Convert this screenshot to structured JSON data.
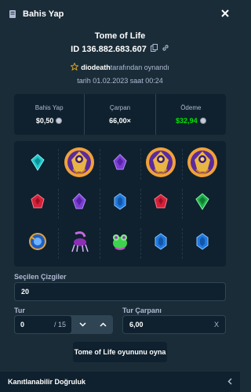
{
  "header": {
    "title": "Bahis Yap",
    "icon": "bet-slip-icon",
    "close_icon": "close-icon"
  },
  "game": {
    "title": "Tome of Life"
  },
  "bet": {
    "id": "ID 136.882.683.607"
  },
  "player": {
    "name": "diodeath",
    "suffix": "tarafından oynandı"
  },
  "date": "tarih 01.02.2023 saat 00:24",
  "stats": [
    {
      "label": "Bahis Yap",
      "value": "$0,50",
      "icon": "coin-icon"
    },
    {
      "label": "Çarpan",
      "value": "66,00×"
    },
    {
      "label": "Ödeme",
      "value": "$32,94",
      "icon": "coin-icon",
      "color": "#00e701"
    }
  ],
  "reels": [
    [
      "gem-cyan",
      "scarab-scatter",
      "gem-purple",
      "scarab-scatter",
      "scarab-scatter"
    ],
    [
      "gem-red",
      "gem-purple",
      "gem-blue",
      "gem-red",
      "gem-green"
    ],
    [
      "amulet-blue",
      "purple-scorpion",
      "green-frog",
      "gem-blue",
      "gem-blue"
    ]
  ],
  "lines": {
    "label": "Seçilen Çizgiler",
    "value": "20"
  },
  "rounds": {
    "label": "Tur",
    "value": "0",
    "max": "/ 15"
  },
  "round_multiplier": {
    "label": "Tur Çarpanı",
    "value": "6,00",
    "suffix": "X"
  },
  "play_button": "Tome of Life oyununu oyna",
  "footer": {
    "label": "Kanıtlanabilir Doğruluk",
    "icon": "chevron-left-icon"
  },
  "colors": {
    "background": "#1a2c38",
    "panel": "#0f212e",
    "border": "#2f4553",
    "muted": "#b1bad3",
    "win": "#00e701"
  }
}
